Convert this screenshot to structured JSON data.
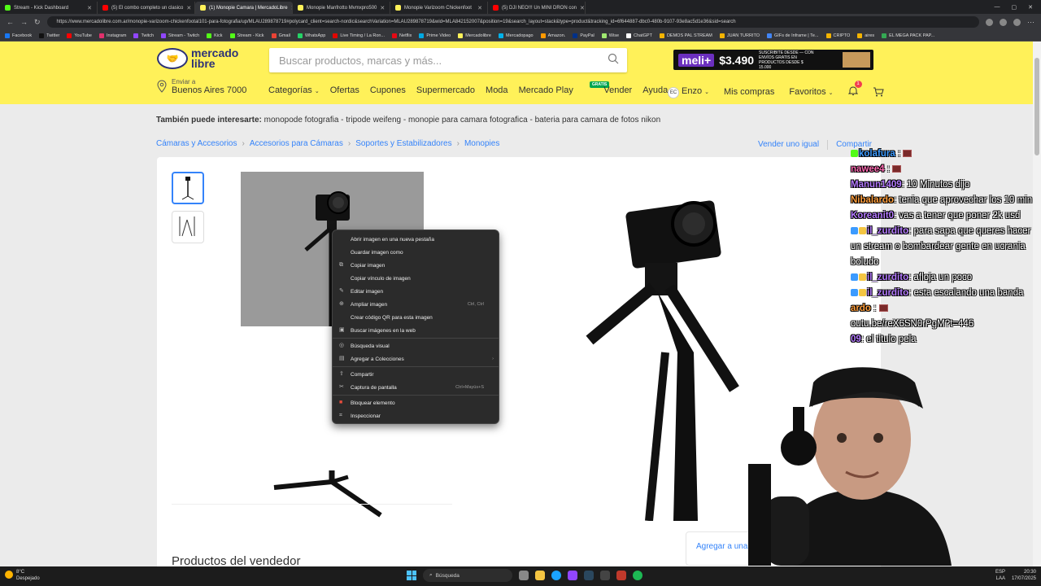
{
  "browser": {
    "tabs": [
      {
        "label": "Stream - Kick Dashboard",
        "color": "#53fc18"
      },
      {
        "label": "(5) El combo completo un clasico",
        "color": "#ff0000"
      },
      {
        "label": "(1) Monopie Camara | MercadoLibre",
        "color": "#fff159"
      },
      {
        "label": "Monopie Manfrotto Mvmxpro500",
        "color": "#fff159"
      },
      {
        "label": "Monopie Varizoom Chickenfoot",
        "color": "#fff159"
      },
      {
        "label": "(5) DJI NEO!!! Un MINI DRON con",
        "color": "#ff0000"
      }
    ],
    "url": "https://www.mercadolibre.com.ar/monopie-varizoom-chickenfootal101-para-fotografia/up/MLAU289878719#polycard_client=search-nordic&searchVariation=MLAU289878719&wid=MLA842152007&position=19&search_layout=stack&type=product&tracking_id=6f644887-dbc0-480b-9107-93e8ac5d1e36&sid=search",
    "bookmarks": [
      {
        "label": "Facebook",
        "color": "#1877f2"
      },
      {
        "label": "Twitter",
        "color": "#111111"
      },
      {
        "label": "YouTube",
        "color": "#ff0000"
      },
      {
        "label": "Instagram",
        "color": "#e1306c"
      },
      {
        "label": "Twitch",
        "color": "#9146ff"
      },
      {
        "label": "Stream - Twitch",
        "color": "#9146ff"
      },
      {
        "label": "Kick",
        "color": "#53fc18"
      },
      {
        "label": "Stream - Kick",
        "color": "#53fc18"
      },
      {
        "label": "Gmail",
        "color": "#ea4335"
      },
      {
        "label": "WhatsApp",
        "color": "#25d366"
      },
      {
        "label": "Live Timing / La Ron...",
        "color": "#e10600"
      },
      {
        "label": "Netflix",
        "color": "#e50914"
      },
      {
        "label": "Prime Video",
        "color": "#00a8e1"
      },
      {
        "label": "Mercadolibre",
        "color": "#fff159"
      },
      {
        "label": "Mercadopago",
        "color": "#00b1ea"
      },
      {
        "label": "Amazon.",
        "color": "#ff9900"
      },
      {
        "label": "PayPal",
        "color": "#003087"
      },
      {
        "label": "Wise",
        "color": "#9fe870"
      },
      {
        "label": "ChatGPT",
        "color": "#ffffff"
      },
      {
        "label": "DEMOS PAL STREAM",
        "color": "#f4b400"
      },
      {
        "label": "JUAN TURRITO",
        "color": "#f4b400"
      },
      {
        "label": "GIFs de Inframe | Te...",
        "color": "#4285f4"
      },
      {
        "label": "CRIPTO",
        "color": "#f4b400"
      },
      {
        "label": "aires",
        "color": "#f4b400"
      },
      {
        "label": "EL MEGA PACK PAP...",
        "color": "#34a853"
      }
    ]
  },
  "header": {
    "logo_line1": "mercado",
    "logo_line2": "libre",
    "search_placeholder": "Buscar productos, marcas y más...",
    "promo_badge": "meli+",
    "promo_price": "$3.490",
    "promo_text": "SUSCRIBITE DESDE — CON ENVÍOS GRATIS EN PRODUCTOS DESDE $ 15.000",
    "location_small": "Enviar a",
    "location_big": "Buenos Aires 7000",
    "nav": [
      "Categorías",
      "Ofertas",
      "Cupones",
      "Supermercado",
      "Moda",
      "Mercado Play",
      "Vender",
      "Ayuda"
    ],
    "gratis_badge": "GRATIS",
    "user_initials": "EC",
    "user_name": "Enzo",
    "mis_compras": "Mis compras",
    "favoritos": "Favoritos",
    "notif_count": "1"
  },
  "page": {
    "related_label": "También puede interesarte:",
    "related_items": "monopode fotografia - tripode weifeng - monopie para camara fotografica - bateria para camara de fotos nikon",
    "breadcrumbs": [
      "Cámaras y Accesorios",
      "Accesorios para Cámaras",
      "Soportes y Estabilizadores",
      "Monopies"
    ],
    "vender_igual": "Vender uno igual",
    "compartir": "Compartir",
    "seller_title": "Productos del vendedor",
    "add_list": "Agregar a una lista"
  },
  "context_menu": {
    "items": [
      {
        "label": "Abrir imagen en una nueva pestaña",
        "icon": "new-tab-icon",
        "shortcut": ""
      },
      {
        "label": "Guardar imagen como",
        "icon": "save-icon",
        "shortcut": ""
      },
      {
        "label": "Copiar imagen",
        "icon": "copy-icon",
        "shortcut": ""
      },
      {
        "label": "Copiar vínculo de imagen",
        "icon": "link-icon",
        "shortcut": ""
      },
      {
        "label": "Editar imagen",
        "icon": "edit-icon",
        "shortcut": ""
      },
      {
        "label": "Ampliar imagen",
        "icon": "zoom-icon",
        "shortcut": "Ctrl, Ctrl"
      },
      {
        "label": "Crear código QR para esta imagen",
        "icon": "qr-icon",
        "shortcut": ""
      },
      {
        "label": "Buscar imágenes en la web",
        "icon": "image-search-icon",
        "shortcut": ""
      },
      {
        "label": "Búsqueda visual",
        "icon": "visual-search-icon",
        "shortcut": ""
      },
      {
        "label": "Agregar a Colecciones",
        "icon": "collections-icon",
        "shortcut": ""
      },
      {
        "label": "Compartir",
        "icon": "share-icon",
        "shortcut": ""
      },
      {
        "label": "Captura de pantalla",
        "icon": "screenshot-icon",
        "shortcut": "Ctrl+Mayús+S"
      },
      {
        "label": "Bloquear elemento",
        "icon": "block-icon",
        "shortcut": ""
      },
      {
        "label": "Inspeccionar",
        "icon": "inspect-icon",
        "shortcut": ""
      }
    ]
  },
  "chat": {
    "messages": [
      {
        "user": "kolafura",
        "color": "#3c9bff",
        "text": ""
      },
      {
        "user": "nawee4",
        "color": "#ff6bb3",
        "text": ""
      },
      {
        "user": "Manun1409",
        "color": "#b57bff",
        "text": ": 10 Minutos dijo"
      },
      {
        "user": "Nibalardo",
        "color": "#ff9e3c",
        "text": ": tenia que aprovechar los 10 min"
      },
      {
        "user": "Koreanit0",
        "color": "#b57bff",
        "text": ": vas a tener que poner 2k usd"
      },
      {
        "user": "il_zurdito",
        "color": "#b57bff",
        "text": ": para sapa que queres hacer un stream o bombardear gente en ucrania boludo"
      },
      {
        "user": "il_zurdito",
        "color": "#b57bff",
        "text": ": afloja un poco"
      },
      {
        "user": "il_zurdito",
        "color": "#b57bff",
        "text": ": esta escalando una banda"
      },
      {
        "user": "ardo",
        "color": "#ff9e3c",
        "text": ""
      },
      {
        "user": "",
        "color": "#ffffff",
        "text": "outu.be/reX6SN0rPgM?t=446"
      },
      {
        "user": "09",
        "color": "#b57bff",
        "text": ": el titulo pela"
      }
    ]
  },
  "taskbar": {
    "weather_temp": "8°C",
    "weather_desc": "Despejado",
    "search": "Búsqueda",
    "lang": "ESP",
    "lang2": "LAA",
    "time": "20:30",
    "date": "17/07/2025"
  }
}
